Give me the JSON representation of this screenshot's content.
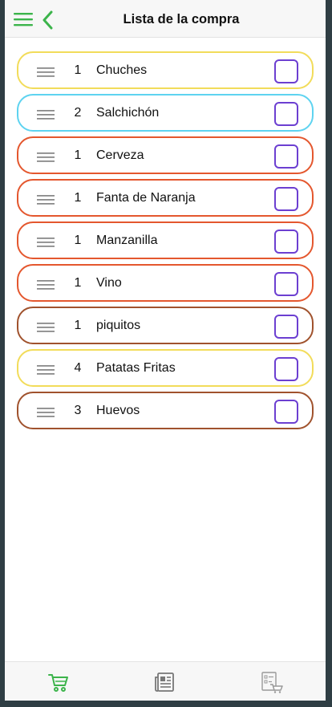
{
  "header": {
    "title": "Lista de la compra",
    "menu_icon": "hamburger-menu-icon",
    "back_icon": "chevron-left-icon",
    "accent": "#3cb44b"
  },
  "items": [
    {
      "qty": "1",
      "name": "Chuches",
      "color": "#f2dc5a",
      "checked": false
    },
    {
      "qty": "2",
      "name": "Salchichón",
      "color": "#5ed3f0",
      "checked": false
    },
    {
      "qty": "1",
      "name": "Cerveza",
      "color": "#e4572e",
      "checked": false
    },
    {
      "qty": "1",
      "name": "Fanta de Naranja",
      "color": "#e4572e",
      "checked": false
    },
    {
      "qty": "1",
      "name": "Manzanilla",
      "color": "#e4572e",
      "checked": false
    },
    {
      "qty": "1",
      "name": "Vino",
      "color": "#e4572e",
      "checked": false
    },
    {
      "qty": "1",
      "name": "piquitos",
      "color": "#a0522d",
      "checked": false
    },
    {
      "qty": "4",
      "name": "Patatas Fritas",
      "color": "#f2dc5a",
      "checked": false
    },
    {
      "qty": "3",
      "name": "Huevos",
      "color": "#a0522d",
      "checked": false
    }
  ],
  "tabbar": {
    "tabs": [
      {
        "icon": "shopping-cart-icon",
        "active": true,
        "color": "#3cb44b"
      },
      {
        "icon": "newspaper-icon",
        "active": false,
        "color": "#777777"
      },
      {
        "icon": "checklist-cart-icon",
        "active": false,
        "color": "#999999"
      }
    ]
  },
  "checkbox_color": "#6c3fd1"
}
